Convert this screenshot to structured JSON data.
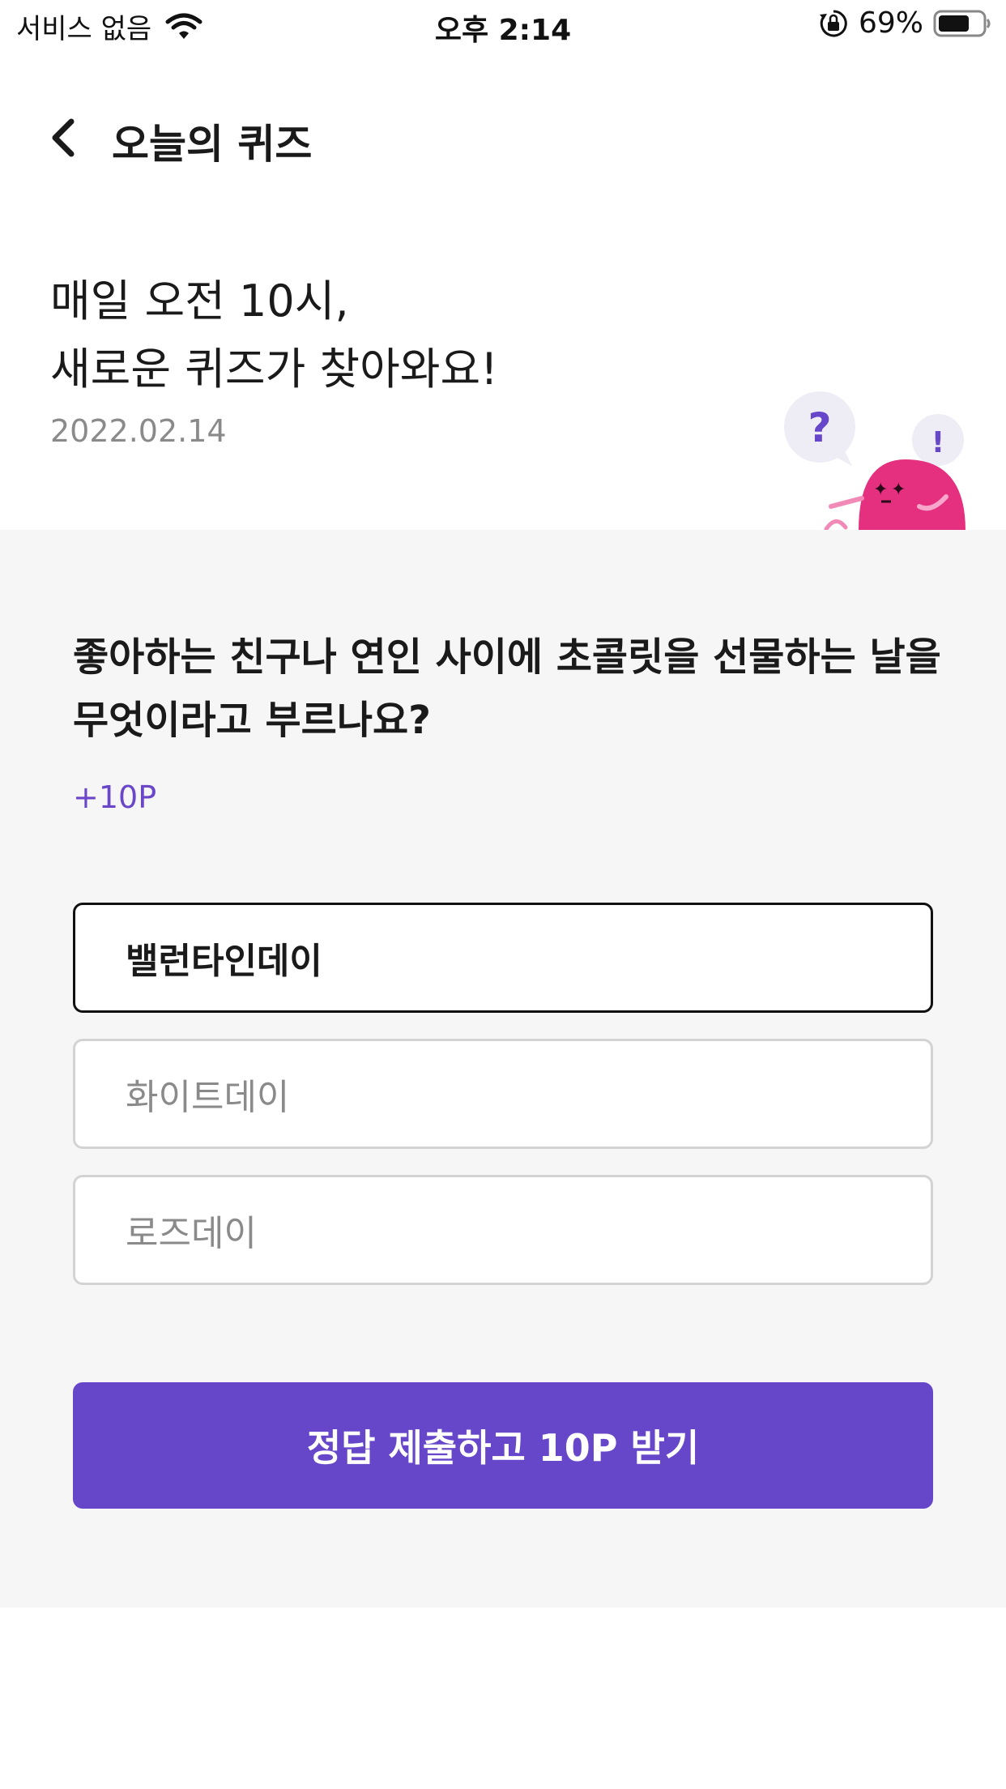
{
  "status_bar": {
    "carrier": "서비스 없음",
    "time": "오후 2:14",
    "battery": "69%"
  },
  "header": {
    "title": "오늘의 퀴즈"
  },
  "intro": {
    "line1": "매일 오전 10시,",
    "line2": "새로운 퀴즈가 찾아와요!",
    "date": "2022.02.14"
  },
  "quiz": {
    "question": "좋아하는 친구나 연인 사이에 초콜릿을 선물하는 날을 무엇이라고 부르나요?",
    "points": "+10P",
    "options": [
      {
        "label": "밸런타인데이",
        "selected": true
      },
      {
        "label": "화이트데이",
        "selected": false
      },
      {
        "label": "로즈데이",
        "selected": false
      }
    ],
    "submit_label": "정답 제출하고 10P 받기"
  },
  "colors": {
    "accent": "#6646c9",
    "panel_bg": "#f6f6f6",
    "mascot_pink": "#e5307f",
    "bubble_bg": "#eeedf5"
  },
  "icons": [
    "wifi-icon",
    "rotation-lock-icon",
    "battery-icon",
    "back-arrow-icon",
    "mascot-illustration"
  ]
}
